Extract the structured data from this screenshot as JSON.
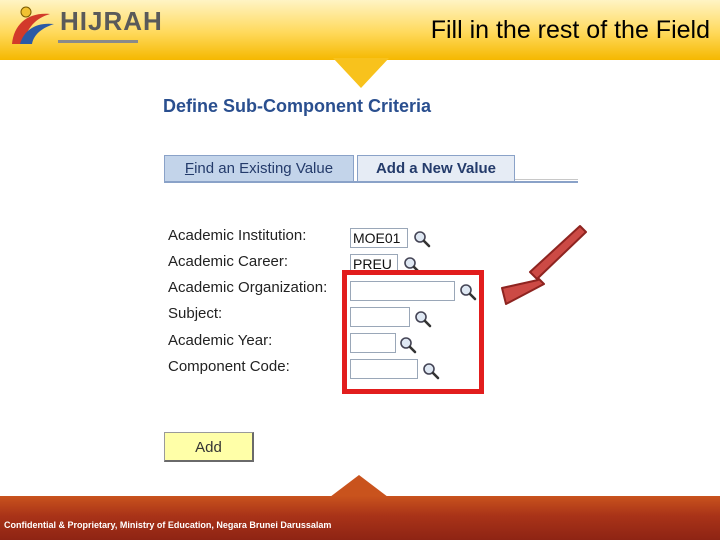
{
  "header": {
    "logo_text": "HIJRAH",
    "slide_title": "Fill in the rest of the Field"
  },
  "page": {
    "heading": "Define Sub-Component Criteria"
  },
  "tabs": [
    {
      "label": "Find an Existing Value",
      "underlined_char": "F",
      "rest": "ind an Existing Value"
    },
    {
      "label": "Add a New Value"
    }
  ],
  "form": {
    "fields": [
      {
        "label": "Academic Institution:",
        "value": "MOE01"
      },
      {
        "label": "Academic Career:",
        "value": "PREU"
      },
      {
        "label": "Academic Organization:",
        "value": ""
      },
      {
        "label": "Subject:",
        "value": ""
      },
      {
        "label": "Academic Year:",
        "value": ""
      },
      {
        "label": "Component Code:",
        "value": ""
      }
    ],
    "add_button_label": "Add"
  },
  "footer": {
    "text": "Confidential & Proprietary, Ministry of Education, Negara Brunei Darussalam"
  },
  "colors": {
    "highlight": "#e21d1d",
    "arrow": "#cc4a45",
    "heading": "#2a4f8f"
  }
}
